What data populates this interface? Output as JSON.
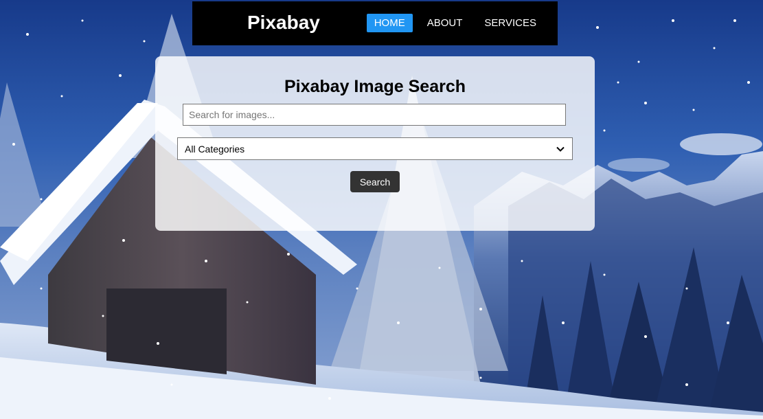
{
  "navbar": {
    "brand": "Pixabay",
    "links": [
      {
        "label": "HOME",
        "active": true
      },
      {
        "label": "ABOUT",
        "active": false
      },
      {
        "label": "SERVICES",
        "active": false
      }
    ]
  },
  "search_panel": {
    "title": "Pixabay Image Search",
    "search_placeholder": "Search for images...",
    "search_value": "",
    "category_selected": "All Categories",
    "search_button_label": "Search"
  },
  "colors": {
    "nav_background": "#000000",
    "active_link": "#2196f3",
    "button_background": "#333333"
  },
  "icons": {
    "select_arrow": "chevron-down-icon"
  }
}
